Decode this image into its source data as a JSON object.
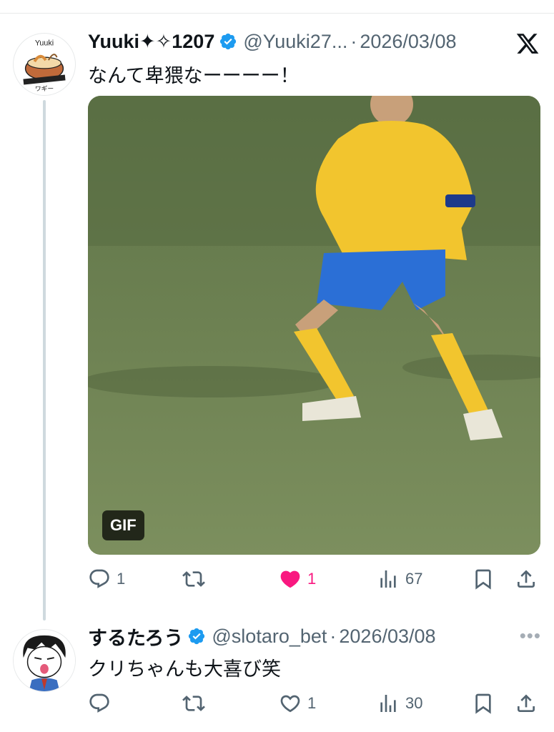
{
  "tweets": [
    {
      "display_name": "Yuuki✦✧1207",
      "handle": "@Yuuki27...",
      "date": "2026/03/08",
      "text": "なんて卑猥なーーーー！",
      "media_badge": "GIF",
      "avatar_text_top": "Yuuki",
      "avatar_text_bottom": "ワギー",
      "corner_icon": "x-logo-icon",
      "actions": {
        "replies": "1",
        "reposts": "",
        "likes": "1",
        "liked": true,
        "views": "67"
      }
    },
    {
      "display_name": "するたろう",
      "handle": "@slotaro_bet",
      "date": "2026/03/08",
      "text": "クリちゃんも大喜び笑",
      "corner_icon": "more-icon",
      "actions": {
        "replies": "",
        "reposts": "",
        "likes": "1",
        "liked": false,
        "views": "30"
      }
    }
  ],
  "colors": {
    "verified": "#1d9bf0",
    "like": "#f91880",
    "muted": "#536471",
    "thread_line": "#cfd9de"
  }
}
